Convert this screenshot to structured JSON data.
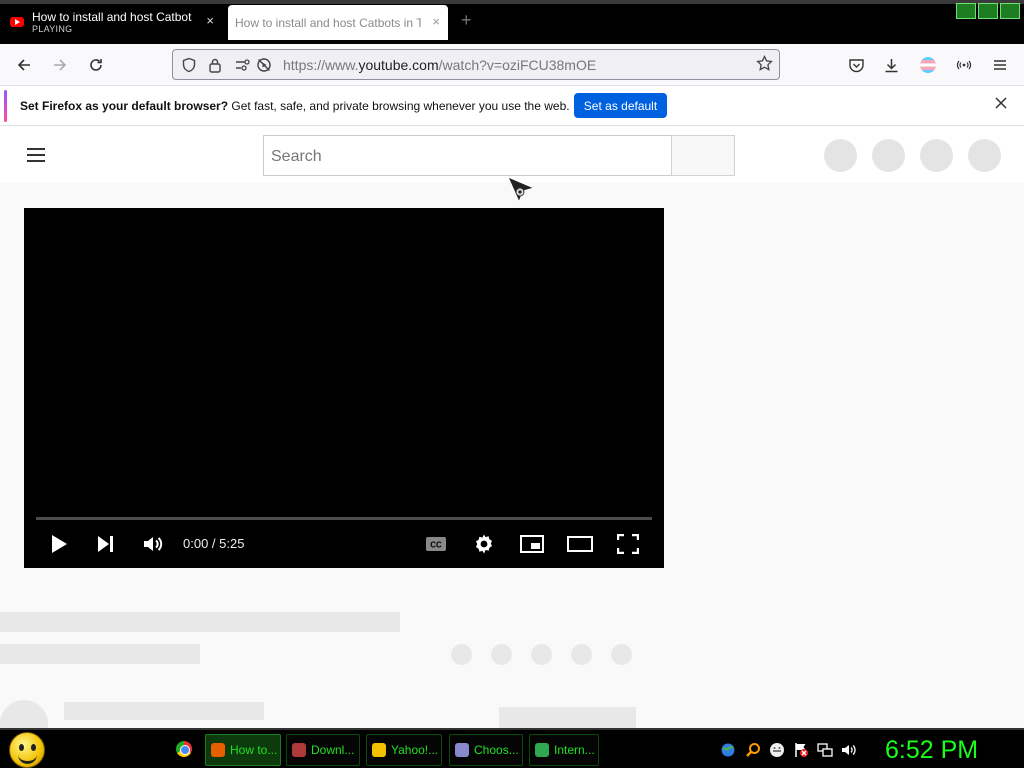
{
  "browser": {
    "tabs": [
      {
        "title": "How to install and host Catbots",
        "status": "PLAYING",
        "close": "×"
      },
      {
        "title": "How to install and host Catbots in T",
        "close": "×"
      }
    ],
    "new_tab": "+",
    "url_prefix": "https://www.",
    "url_domain": "youtube.com",
    "url_path": "/watch?v=oziFCU38mOE"
  },
  "notification": {
    "bold_text": "Set Firefox as your default browser?",
    "text": " Get fast, safe, and private browsing whenever you use the web.",
    "button_label": "Set as default",
    "close": "×"
  },
  "youtube": {
    "search_placeholder": "Search",
    "player": {
      "time": "0:00 / 5:25",
      "progress": 0
    }
  },
  "taskbar": {
    "items": [
      {
        "label": "How to...",
        "icon": "firefox-icon",
        "color": "#e66000",
        "active": true
      },
      {
        "label": "Downl...",
        "icon": "download-icon",
        "color": "#b03a3a",
        "active": false
      },
      {
        "label": "Yahoo!...",
        "icon": "yahoo-messenger-icon",
        "color": "#f2c200",
        "active": false
      },
      {
        "label": "Choos...",
        "icon": "control-panel-icon",
        "color": "#8888cc",
        "active": false
      },
      {
        "label": "Intern...",
        "icon": "network-icon",
        "color": "#2fa84f",
        "active": false
      }
    ],
    "clock": "6:52 PM"
  }
}
